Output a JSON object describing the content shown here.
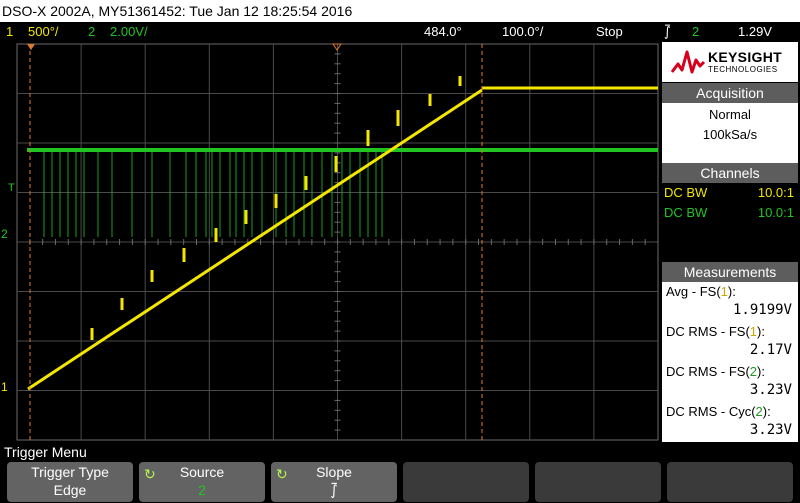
{
  "title_bar": {
    "text": "DSO-X 2002A, MY51361452: Tue Jan 12 18:25:54 2016"
  },
  "status_bar": {
    "ch1_num": "1",
    "ch1_scale": "500°/",
    "ch2_num": "2",
    "ch2_scale": "2.00V/",
    "time_offset": "484.0°",
    "time_scale": "100.0°/",
    "run_state": "Stop",
    "trigger_source": "2",
    "trigger_level": "1.29V",
    "trigger_symbol": "⨛"
  },
  "logo": {
    "name": "KEYSIGHT",
    "sub": "TECHNOLOGIES"
  },
  "acquisition": {
    "header": "Acquisition",
    "mode": "Normal",
    "rate": "100kSa/s"
  },
  "channels": {
    "header": "Channels",
    "rows": [
      {
        "coupling": "DC BW",
        "probe": "10.0:1"
      },
      {
        "coupling": "DC BW",
        "probe": "10.0:1"
      }
    ]
  },
  "measurements": {
    "header": "Measurements",
    "items": [
      {
        "label_pre": "Avg - FS(",
        "ch": "1",
        "label_post": "):",
        "value": "1.9199V"
      },
      {
        "label_pre": "DC RMS - FS(",
        "ch": "1",
        "label_post": "):",
        "value": "2.17V"
      },
      {
        "label_pre": "DC RMS - FS(",
        "ch": "2",
        "label_post": "):",
        "value": "3.23V"
      },
      {
        "label_pre": "DC RMS - Cyc(",
        "ch": "2",
        "label_post": "):",
        "value": "3.23V"
      }
    ]
  },
  "menu": {
    "title": "Trigger Menu",
    "keys": [
      {
        "label": "Trigger Type",
        "value": "Edge"
      },
      {
        "label": "Source",
        "value": "2"
      },
      {
        "label": "Slope",
        "value": "⨛"
      }
    ]
  },
  "markers": {
    "ch1_ground": "1",
    "ch2_ground": "2",
    "trigger": "T"
  },
  "colors": {
    "ch1": "#f5e600",
    "ch2": "#22c422",
    "cursor": "#e07a2a",
    "grid": "#555555"
  }
}
